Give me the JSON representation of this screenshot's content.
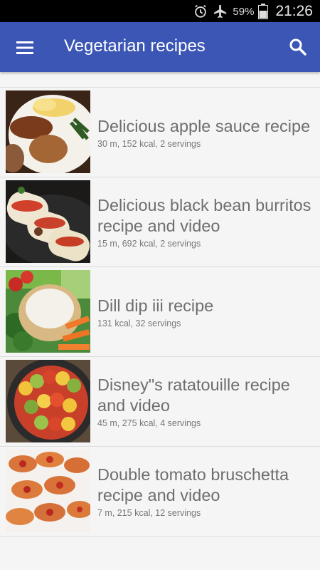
{
  "status": {
    "battery": "59%",
    "time": "21:26"
  },
  "toolbar": {
    "title": "Vegetarian recipes"
  },
  "recipes": [
    {
      "title": "Delicious apple sauce recipe",
      "meta": "30 m, 152 kcal, 2 servings"
    },
    {
      "title": "Delicious black bean burritos recipe and video",
      "meta": "15 m, 692 kcal, 2 servings"
    },
    {
      "title": "Dill dip iii recipe",
      "meta": "131 kcal, 32 servings"
    },
    {
      "title": "Disney\"s ratatouille recipe and video",
      "meta": "45 m, 275 kcal, 4 servings"
    },
    {
      "title": "Double tomato bruschetta recipe and video",
      "meta": "7 m, 215 kcal, 12 servings"
    }
  ]
}
